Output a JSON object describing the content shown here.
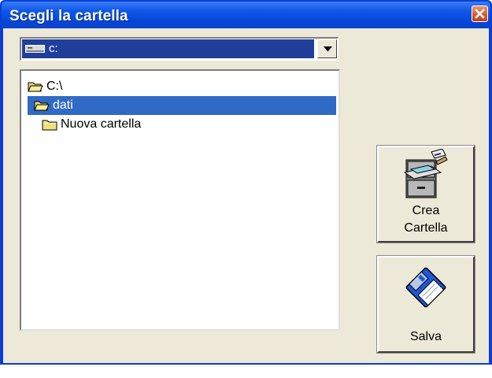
{
  "window": {
    "title": "Scegli la cartella"
  },
  "drive_combo": {
    "selected": "c:"
  },
  "folder_tree": {
    "items": [
      {
        "label": "C:\\",
        "state": "open"
      },
      {
        "label": "dati",
        "state": "open-selected"
      },
      {
        "label": "Nuova cartella",
        "state": "closed"
      }
    ]
  },
  "buttons": {
    "create_folder": {
      "line1": "Crea",
      "line2": "Cartella",
      "icon": "file-cabinet-icon"
    },
    "save": {
      "label": "Salva",
      "icon": "floppy-disk-icon"
    }
  },
  "colors": {
    "title_bar": "#0546d9",
    "selection": "#316ac5",
    "face": "#ece9d8"
  }
}
